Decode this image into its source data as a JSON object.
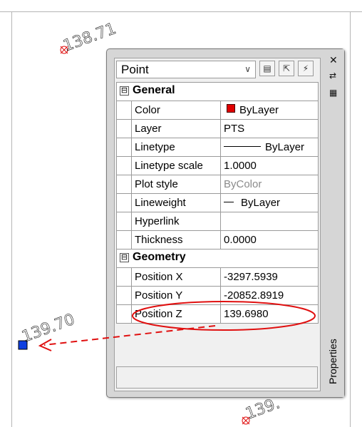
{
  "drawing": {
    "labels": [
      "138.71",
      "139.70",
      "139."
    ],
    "annotation_color": "#e01010",
    "selected_point_color": "#1040e0"
  },
  "properties_palette": {
    "title": "Properties",
    "object_type": "Point",
    "toolbar_icons": [
      "quick-select-icon",
      "select-objects-icon",
      "toggle-pickadd-icon"
    ],
    "titlebar_icons": [
      "close-icon",
      "auto-hide-icon",
      "properties-menu-icon"
    ],
    "categories": [
      {
        "name": "General",
        "expander": "⊟",
        "rows": [
          {
            "name": "Color",
            "value": "ByLayer",
            "swatch": "#e00000"
          },
          {
            "name": "Layer",
            "value": "PTS"
          },
          {
            "name": "Linetype",
            "value": "ByLayer"
          },
          {
            "name": "Linetype scale",
            "value": "1.0000"
          },
          {
            "name": "Plot style",
            "value": "ByColor"
          },
          {
            "name": "Lineweight",
            "value": "ByLayer"
          },
          {
            "name": "Hyperlink",
            "value": ""
          },
          {
            "name": "Thickness",
            "value": "0.0000"
          }
        ]
      },
      {
        "name": "Geometry",
        "expander": "⊟",
        "rows": [
          {
            "name": "Position X",
            "value": "-3297.5939"
          },
          {
            "name": "Position Y",
            "value": "-20852.8919"
          },
          {
            "name": "Position Z",
            "value": "139.6980"
          }
        ]
      }
    ]
  }
}
